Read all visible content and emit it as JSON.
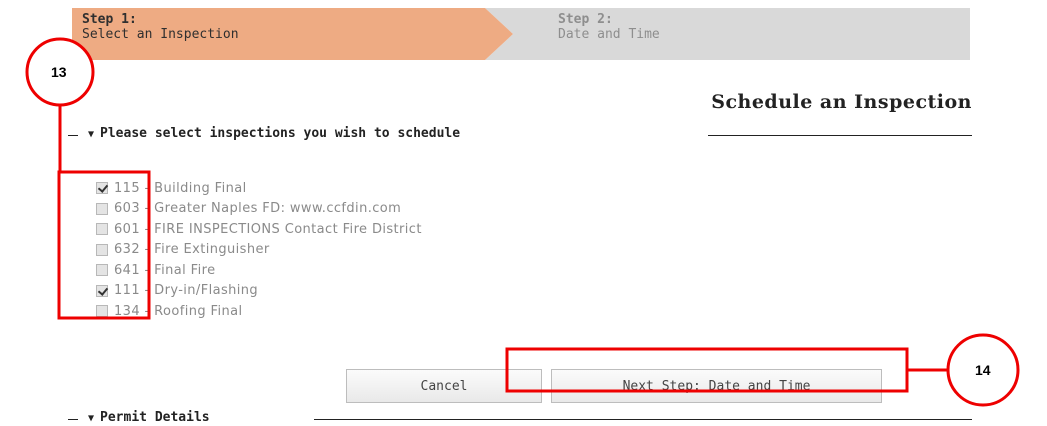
{
  "steps": [
    {
      "title": "Step 1:",
      "subtitle": "Select an Inspection",
      "active": true
    },
    {
      "title": "Step 2:",
      "subtitle": "Date and Time",
      "active": false
    }
  ],
  "page_title": "Schedule an Inspection",
  "inspections_section": {
    "label": "Please select inspections you wish to schedule"
  },
  "inspections": [
    {
      "label": "115 - Building Final",
      "checked": true
    },
    {
      "label": "603 - Greater Naples FD: www.ccfdin.com",
      "checked": false
    },
    {
      "label": "601 - FIRE INSPECTIONS Contact Fire District",
      "checked": false
    },
    {
      "label": "632 - Fire Extinguisher",
      "checked": false
    },
    {
      "label": "641 - Final Fire",
      "checked": false
    },
    {
      "label": "111 - Dry-in/Flashing",
      "checked": true
    },
    {
      "label": "134 - Roofing Final",
      "checked": false
    }
  ],
  "buttons": {
    "cancel": "Cancel",
    "next": "Next Step: Date and Time"
  },
  "permit_section": {
    "label": "Permit Details"
  },
  "callouts": {
    "left": "13",
    "right": "14"
  },
  "colors": {
    "active_step": "#eeab83",
    "inactive_step": "#d9d9d9",
    "annotation": "#ee0000"
  }
}
